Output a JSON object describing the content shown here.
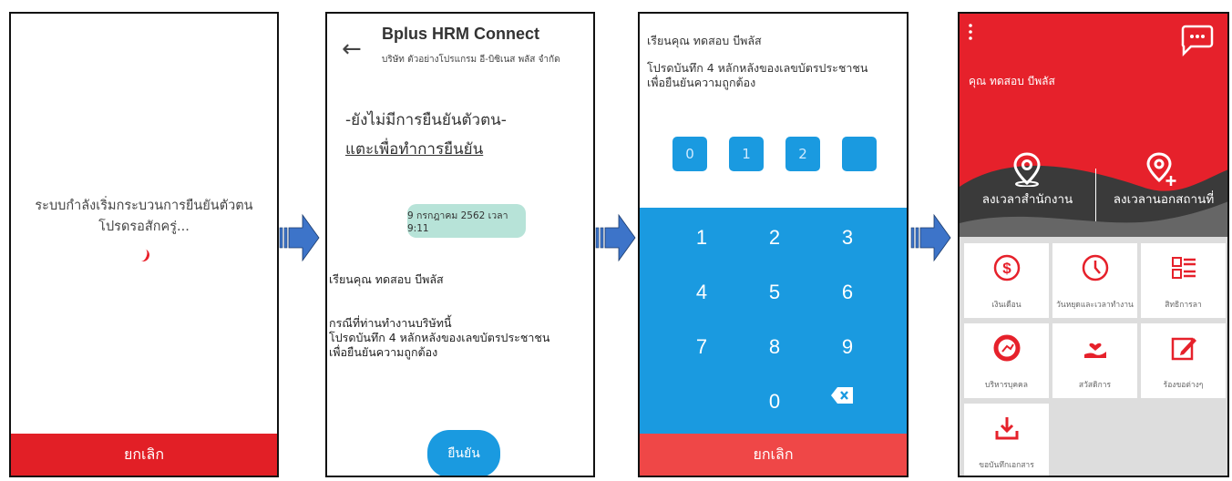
{
  "screen1": {
    "message_line1": "ระบบกำลังเริ่มกระบวนการยืนยันตัวตน",
    "message_line2": "โปรดรอสักครู่...",
    "cancel_label": "ยกเลิก"
  },
  "screen2": {
    "app_title": "Bplus HRM Connect",
    "company": "บริษัท ตัวอย่างโปรแกรม อี-บิซิเนส พลัส จำกัด",
    "status": "-ยังไม่มีการยืนยันตัวตน-",
    "verify_link": "แตะเพื่อทำการยืนยัน",
    "date_badge": "9 กรกฎาคม 2562 เวลา 9:11",
    "greeting": "เรียนคุณ ทดสอบ บีพลัส",
    "body_line1": "กรณีที่ท่านทำงานบริษัทนี้",
    "body_line2": "โปรดบันทึก 4 หลักหลังของเลขบัตรประชาชน",
    "body_line3": "เพื่อยืนยันความถูกต้อง",
    "confirm_label": "ยืนยัน"
  },
  "screen3": {
    "greeting": "เรียนคุณ ทดสอบ บีพลัส",
    "instruction_line1": "โปรดบันทึก 4 หลักหลังของเลขบัตรประชาชน",
    "instruction_line2": "เพื่อยืนยันความถูกต้อง",
    "pin_digits": [
      "0",
      "1",
      "2",
      ""
    ],
    "keys": [
      "1",
      "2",
      "3",
      "4",
      "5",
      "6",
      "7",
      "8",
      "9",
      "0"
    ],
    "cancel_label": "ยกเลิก"
  },
  "screen4": {
    "user_name": "คุณ ทดสอบ บีพลัส",
    "checkin_office": "ลงเวลาสำนักงาน",
    "checkin_outside": "ลงเวลานอกสถานที่",
    "tiles": [
      {
        "label": "เงินเดือน",
        "icon": "dollar-icon"
      },
      {
        "label": "วันหยุดและเวลาทำงาน",
        "icon": "clock-icon"
      },
      {
        "label": "สิทธิการลา",
        "icon": "list-icon"
      },
      {
        "label": "บริหารบุคคล",
        "icon": "gauge-icon"
      },
      {
        "label": "สวัสดิการ",
        "icon": "care-hand-icon"
      },
      {
        "label": "ร้องขอต่างๆ",
        "icon": "edit-icon"
      },
      {
        "label": "ขอบันทึกเอกสาร",
        "icon": "download-icon"
      }
    ],
    "brand_red": "#e6212b"
  },
  "colors": {
    "primary_blue": "#1a9ae0",
    "cancel_red": "#e21f26",
    "arrow_blue": "#3d74c9"
  }
}
